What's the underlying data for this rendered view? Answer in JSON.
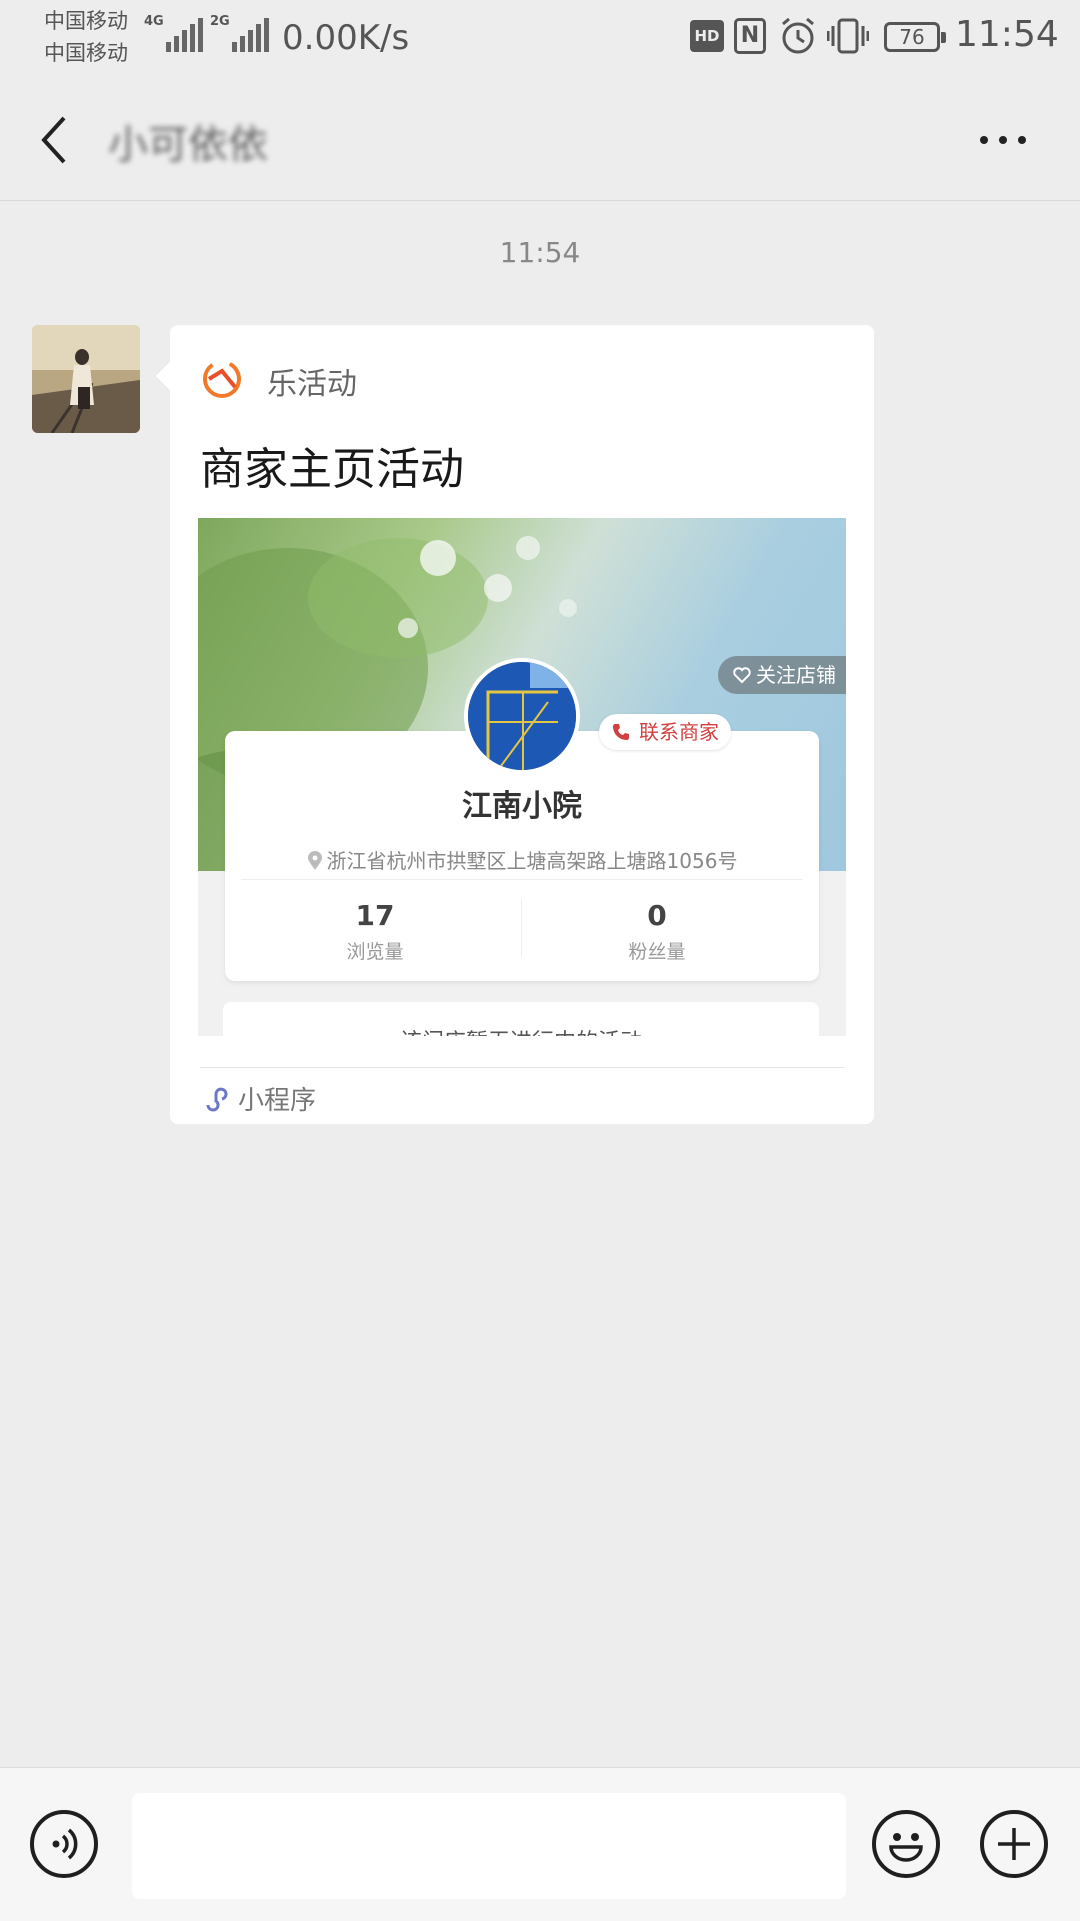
{
  "status_bar": {
    "carrier_1": "中国移动",
    "carrier_2": "中国移动",
    "sim1_network": "4G",
    "sim2_network": "2G",
    "net_speed": "0.00K/s",
    "battery": "76",
    "time": "11:54",
    "icons": [
      "hd-icon",
      "nfc-icon",
      "alarm-icon",
      "vibrate-icon",
      "battery-icon"
    ]
  },
  "nav": {
    "title": "小可依依",
    "back_icon": "chevron-left-icon",
    "more_icon": "more-dots-icon"
  },
  "chat": {
    "timestamp": "11:54",
    "message": {
      "app_name": "乐活动",
      "title": "商家主页活动",
      "preview": {
        "follow_label": "关注店铺",
        "contact_label": "联系商家",
        "shop_name": "江南小院",
        "address": "浙江省杭州市拱墅区上塘高架路上塘路1056号",
        "views_count": "17",
        "views_label": "浏览量",
        "fans_count": "0",
        "fans_label": "粉丝量",
        "empty_notice": "该门店暂无进行中的活动"
      },
      "footer_label": "小程序"
    }
  },
  "input_bar": {
    "voice_icon": "voice-icon",
    "emoji_icon": "emoji-icon",
    "plus_icon": "plus-icon",
    "text_value": ""
  },
  "colors": {
    "background": "#ededed",
    "card": "#ffffff",
    "contact_red": "#d0413f",
    "app_logo_orange": "#f07a2a"
  }
}
